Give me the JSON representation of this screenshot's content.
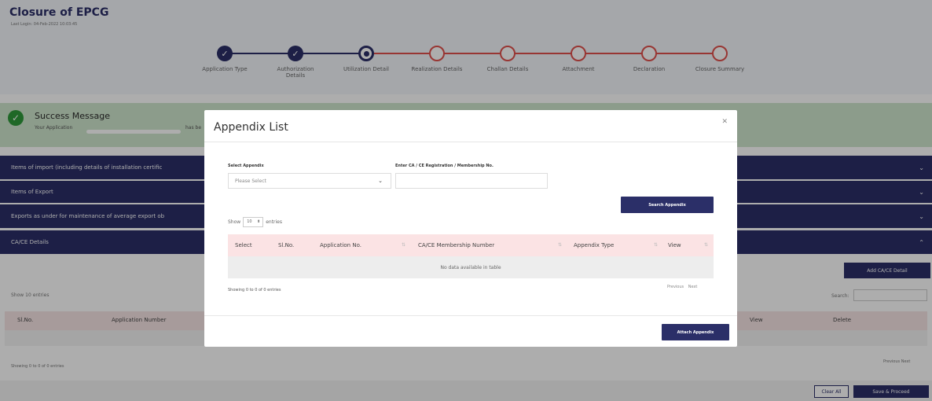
{
  "app": {
    "title": "Closure of EPCG",
    "last_login": "Last Login: 04-Feb-2022 10:03:45"
  },
  "stepper": {
    "steps": [
      {
        "label": "Application Type",
        "state": "done"
      },
      {
        "label": "Authorization Details",
        "state": "done"
      },
      {
        "label": "Utilization Detail",
        "state": "current"
      },
      {
        "label": "Realization Details",
        "state": "todo"
      },
      {
        "label": "Challan Details",
        "state": "todo"
      },
      {
        "label": "Attachment",
        "state": "todo"
      },
      {
        "label": "Declaration",
        "state": "todo"
      },
      {
        "label": "Closure Summary",
        "state": "todo"
      }
    ],
    "done_color": "#2b2f68",
    "todo_color": "#e1504c"
  },
  "success": {
    "title": "Success Message",
    "text": "Your Application",
    "text_suffix": "has be",
    "icon": "check-icon"
  },
  "sections": [
    {
      "label": "Items of import (including details of installation certific",
      "chevron": "chevron-down-icon"
    },
    {
      "label": "Items of Export",
      "chevron": "chevron-down-icon"
    },
    {
      "label": "Exports as under for maintenance of average export ob",
      "chevron": "chevron-down-icon"
    },
    {
      "label": "CA/CE Details",
      "chevron": "chevron-up-icon"
    }
  ],
  "background_table": {
    "add_button": "Add CA/CE Detail",
    "show_label": "Show",
    "entries_value": "10",
    "entries_label": "entries",
    "search_label": "Search:",
    "headers": [
      "Sl.No.",
      "Application Number",
      "View",
      "Delete"
    ],
    "info": "Showing 0 to 0 of 0 entries",
    "pager": "Previous   Next",
    "clear_all": "Clear All",
    "save_proceed": "Save & Proceed"
  },
  "modal": {
    "title": "Appendix List",
    "close_icon": "close-icon",
    "select_label": "Select Appendix",
    "select_placeholder": "Please Select",
    "input_label": "Enter CA / CE Registration / Membership No.",
    "input_value": "",
    "search_button": "Search Appendix",
    "show_label": "Show",
    "entries_value": "10",
    "entries_label": "entries",
    "columns": [
      "Select",
      "Sl.No.",
      "Application No.",
      "CA/CE Membership Number",
      "Appendix Type",
      "View"
    ],
    "empty_text": "No data available in table",
    "info": "Showing 0 to 0 of 0 entries",
    "previous": "Previous",
    "next": "Next",
    "attach_button": "Attach Appendix"
  }
}
